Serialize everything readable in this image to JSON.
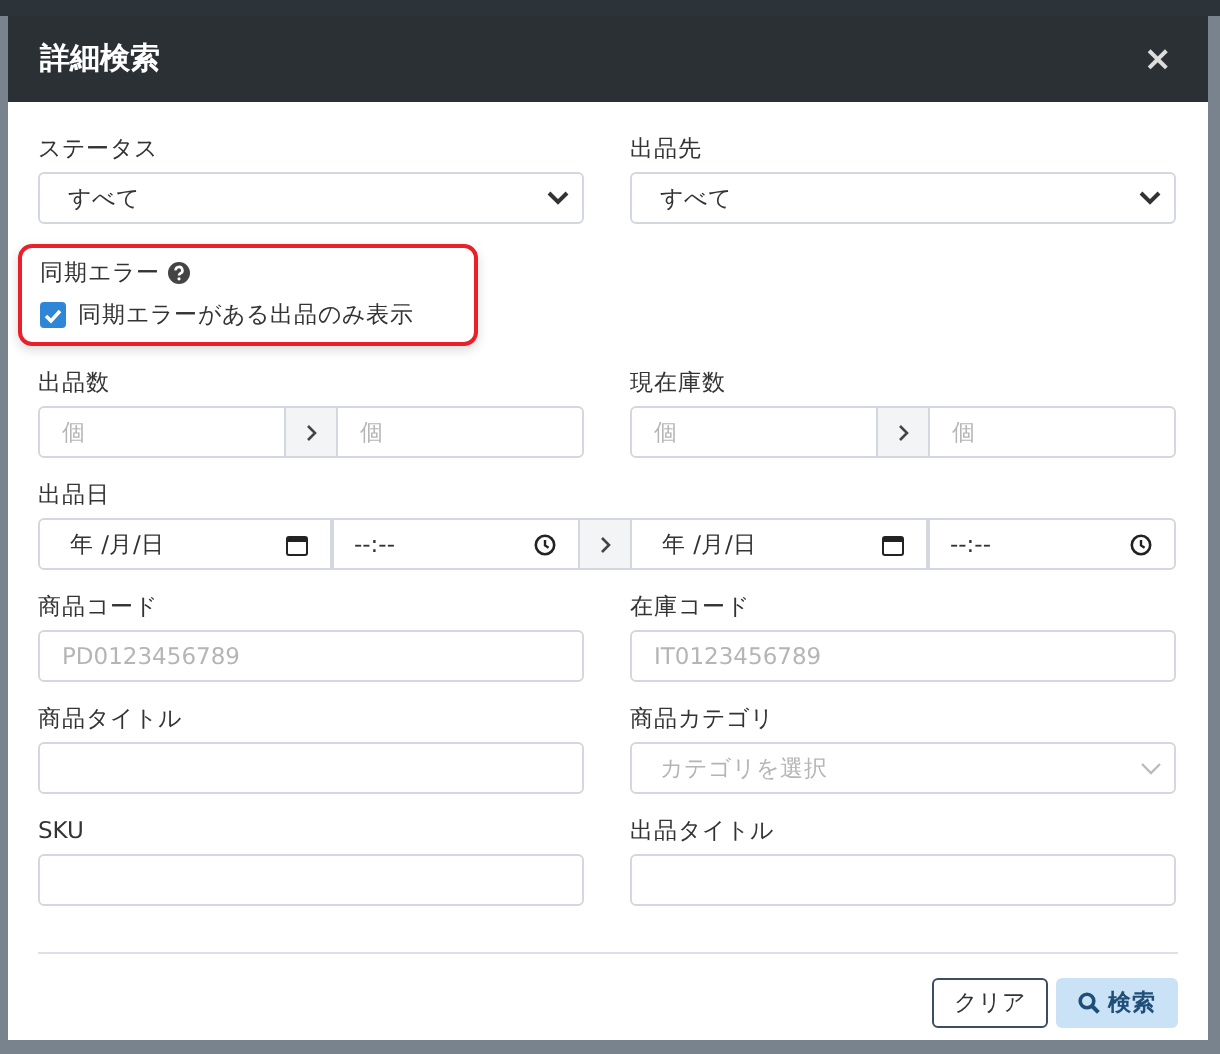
{
  "dialog": {
    "title": "詳細検索",
    "close": "×"
  },
  "fields": [
    {
      "kind": "select",
      "label": "ステータス",
      "value": "すべて"
    },
    {
      "kind": "select",
      "label": "出品先",
      "value": "すべて"
    },
    {
      "kind": "checkgroup",
      "label": "同期エラー",
      "highlighted": true,
      "checkbox": {
        "label": "同期エラーがある出品のみ表示",
        "checked": true
      }
    },
    {
      "kind": "range",
      "label": "出品数",
      "from_placeholder": "個",
      "to_placeholder": "個"
    },
    {
      "kind": "range",
      "label": "現在庫数",
      "from_placeholder": "個",
      "to_placeholder": "個"
    },
    {
      "kind": "datetime-range",
      "label": "出品日",
      "from_date": "年 /月/日",
      "from_time": "--:--",
      "to_date": "年 /月/日",
      "to_time": "--:--"
    },
    {
      "kind": "text",
      "label": "商品コード",
      "placeholder": "PD0123456789"
    },
    {
      "kind": "text",
      "label": "在庫コード",
      "placeholder": "IT0123456789"
    },
    {
      "kind": "text",
      "label": "商品タイトル"
    },
    {
      "kind": "combo",
      "label": "商品カテゴリ",
      "placeholder": "カテゴリを選択"
    },
    {
      "kind": "text",
      "label": "SKU"
    },
    {
      "kind": "text",
      "label": "出品タイトル"
    }
  ],
  "buttons": [
    {
      "label": "クリア",
      "kind": "outline"
    },
    {
      "label": "検索",
      "kind": "primary"
    }
  ]
}
